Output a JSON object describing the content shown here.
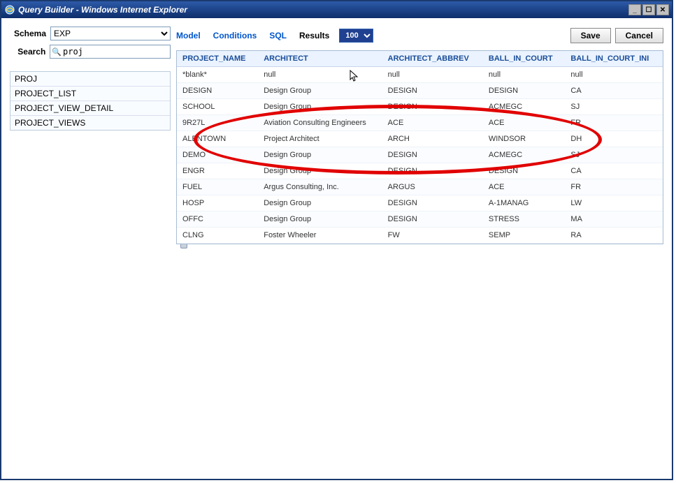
{
  "window": {
    "title": "Query Builder - Windows Internet Explorer"
  },
  "win_controls": {
    "min": "_",
    "max": "☐",
    "close": "✕"
  },
  "schema": {
    "label": "Schema",
    "value": "EXP"
  },
  "search": {
    "label": "Search",
    "value": "proj"
  },
  "objects": [
    "PROJ",
    "PROJECT_LIST",
    "PROJECT_VIEW_DETAIL",
    "PROJECT_VIEWS"
  ],
  "tabs": {
    "model": "Model",
    "conditions": "Conditions",
    "sql": "SQL",
    "results": "Results"
  },
  "result_limit": "100",
  "buttons": {
    "save": "Save",
    "cancel": "Cancel"
  },
  "columns": [
    "PROJECT_NAME",
    "ARCHITECT",
    "ARCHITECT_ABBREV",
    "BALL_IN_COURT",
    "BALL_IN_COURT_INI"
  ],
  "rows": [
    [
      "*blank*",
      "null",
      "null",
      "null",
      "null"
    ],
    [
      "DESIGN",
      "Design Group",
      "DESIGN",
      "DESIGN",
      "CA"
    ],
    [
      "SCHOOL",
      "Design Group",
      "DESIGN",
      "ACMEGC",
      "SJ"
    ],
    [
      "9R27L",
      "Aviation Consulting Engineers",
      "ACE",
      "ACE",
      "FR"
    ],
    [
      "ALENTOWN",
      "Project Architect",
      "ARCH",
      "WINDSOR",
      "DH"
    ],
    [
      "DEMO",
      "Design Group",
      "DESIGN",
      "ACMEGC",
      "SJ"
    ],
    [
      "ENGR",
      "Design Group",
      "DESIGN",
      "DESIGN",
      "CA"
    ],
    [
      "FUEL",
      "Argus Consulting, Inc.",
      "ARGUS",
      "ACE",
      "FR"
    ],
    [
      "HOSP",
      "Design Group",
      "DESIGN",
      "A-1MANAG",
      "LW"
    ],
    [
      "OFFC",
      "Design Group",
      "DESIGN",
      "STRESS",
      "MA"
    ],
    [
      "CLNG",
      "Foster Wheeler",
      "FW",
      "SEMP",
      "RA"
    ]
  ]
}
